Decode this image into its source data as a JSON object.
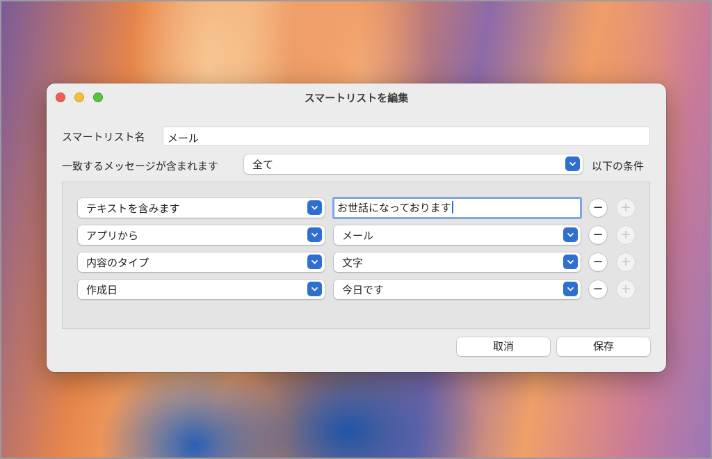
{
  "window": {
    "title": "スマートリストを編集"
  },
  "form": {
    "name_label": "スマートリスト名",
    "name_value": "メール",
    "match_label": "一致するメッセージが含まれます",
    "match_value": "全て",
    "match_suffix": "以下の条件"
  },
  "rules": [
    {
      "field": "テキストを含みます",
      "value": "お世話になっております",
      "value_kind": "text"
    },
    {
      "field": "アプリから",
      "value": "メール",
      "value_kind": "select"
    },
    {
      "field": "内容のタイプ",
      "value": "文字",
      "value_kind": "select"
    },
    {
      "field": "作成日",
      "value": "今日です",
      "value_kind": "select"
    }
  ],
  "rule_buttons": {
    "remove": "−",
    "add": "+"
  },
  "footer": {
    "cancel_label": "取消",
    "save_label": "保存"
  },
  "colors": {
    "accent": "#2f6fd0",
    "focus_ring": "#7ea6e0",
    "close": "#ed5f55",
    "minimize": "#f4bd3b",
    "maximize": "#5ac143"
  },
  "icons": {
    "close": "close-icon",
    "minimize": "minimize-icon",
    "maximize": "maximize-icon",
    "popup": "chevron-updown-icon",
    "remove": "minus-icon",
    "add": "plus-icon"
  }
}
